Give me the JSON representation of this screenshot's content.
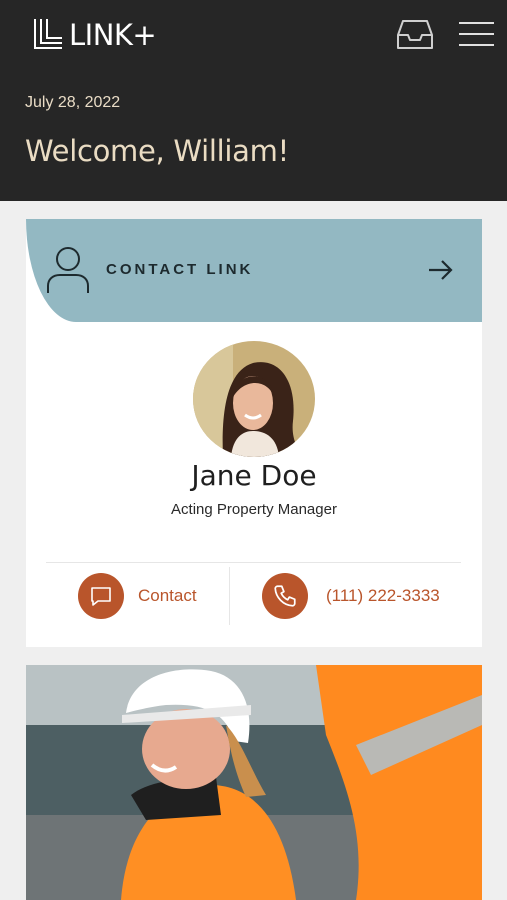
{
  "header": {
    "brand": "LINK+",
    "date": "July 28, 2022",
    "welcome": "Welcome, William!",
    "icons": [
      "inbox-icon",
      "hamburger-menu-icon"
    ]
  },
  "contact_card": {
    "label": "CONTACT LINK",
    "name": "Jane Doe",
    "role": "Acting Property Manager",
    "contact_label": "Contact",
    "phone": "(111) 222-3333",
    "colors": {
      "header_bg": "#93b8c2",
      "accent": "#b9552b",
      "top_bar": "#262626",
      "greeting": "#eadcc3"
    },
    "icons": [
      "person-icon",
      "arrow-right-icon",
      "chat-icon",
      "phone-icon"
    ]
  }
}
